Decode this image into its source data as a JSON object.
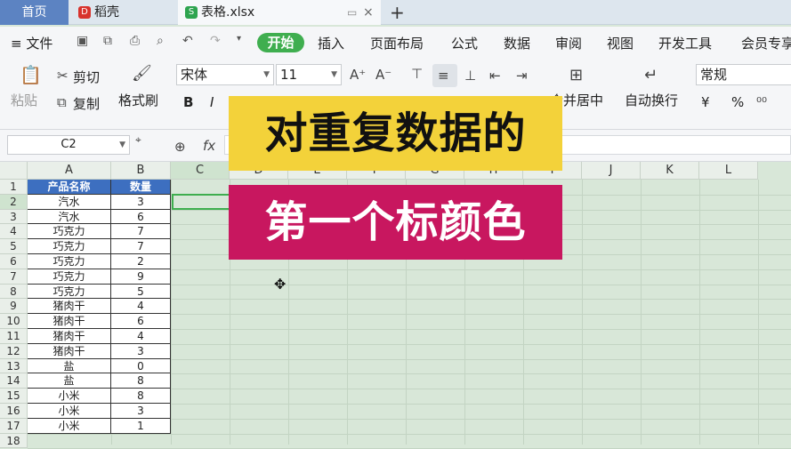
{
  "tabs": {
    "home": "首页",
    "doc": "稻壳",
    "file": "表格.xlsx",
    "plus": "+"
  },
  "menu": {
    "file": "≡ 文件",
    "start": "开始",
    "items": [
      "插入",
      "页面布局",
      "公式",
      "数据",
      "审阅",
      "视图",
      "开发工具",
      "会员专享"
    ]
  },
  "ribbon": {
    "paste": "粘贴",
    "cut": "剪切",
    "copy": "复制",
    "format_painter": "格式刷",
    "font": "宋体",
    "size": "11",
    "bold": "B",
    "italic": "I",
    "merge": "合并居中",
    "wrap": "自动换行",
    "number_format": "常规",
    "currency": "¥",
    "percent": "%"
  },
  "formula": {
    "cell_ref": "C2",
    "fx": "fx"
  },
  "columns": [
    "A",
    "B",
    "C",
    "D",
    "E",
    "F",
    "G",
    "H",
    "I",
    "J",
    "K",
    "L"
  ],
  "rows": [
    "1",
    "2",
    "3",
    "4",
    "5",
    "6",
    "7",
    "8",
    "9",
    "10",
    "11",
    "12",
    "13",
    "14",
    "15",
    "16",
    "17",
    "18"
  ],
  "table": {
    "headers": [
      "产品名称",
      "数量"
    ],
    "rows": [
      [
        "汽水",
        "3"
      ],
      [
        "汽水",
        "6"
      ],
      [
        "巧克力",
        "7"
      ],
      [
        "巧克力",
        "7"
      ],
      [
        "巧克力",
        "2"
      ],
      [
        "巧克力",
        "9"
      ],
      [
        "巧克力",
        "5"
      ],
      [
        "猪肉干",
        "4"
      ],
      [
        "猪肉干",
        "6"
      ],
      [
        "猪肉干",
        "4"
      ],
      [
        "猪肉干",
        "3"
      ],
      [
        "盐",
        "0"
      ],
      [
        "盐",
        "8"
      ],
      [
        "小米",
        "8"
      ],
      [
        "小米",
        "3"
      ],
      [
        "小米",
        "1"
      ]
    ]
  },
  "overlay": {
    "line1": "对重复数据的",
    "line2": "第一个标颜色"
  },
  "colors": {
    "accent": "#3fae4f",
    "header_fill": "#3d6fc0",
    "overlay_yellow": "#f3d23a",
    "overlay_pink": "#c8175f"
  }
}
